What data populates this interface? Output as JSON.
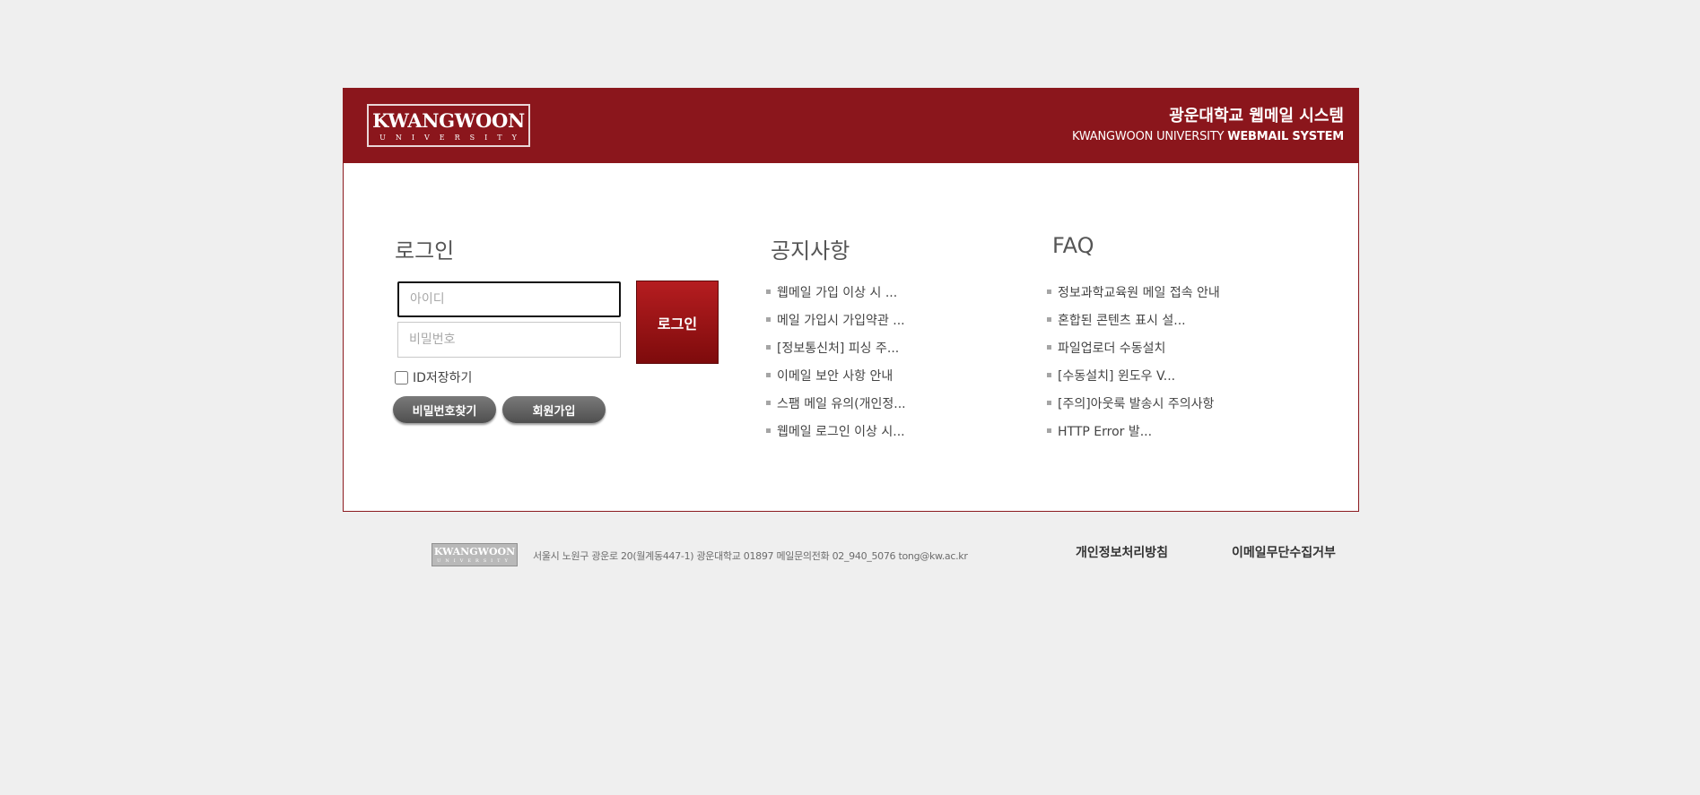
{
  "header": {
    "logo_main": "KWANGWOON",
    "logo_sub": "UNIVERSITY",
    "title_kr": "광운대학교 웹메일 시스템",
    "title_en_prefix": "KWANGWOON UNIVERSITY",
    "title_en_bold": "WEBMAIL SYSTEM"
  },
  "login": {
    "title": "로그인",
    "id_placeholder": "아이디",
    "pw_placeholder": "비밀번호",
    "login_button": "로그인",
    "remember_label": "ID저장하기",
    "find_pw_button": "비밀번호찾기",
    "signup_button": "회원가입"
  },
  "notice": {
    "title": "공지사항",
    "items": [
      "웹메일 가입 이상 시 ...",
      "메일 가입시 가입약관 ...",
      "[정보통신처] 피싱 주...",
      "이메일 보안 사항 안내",
      "스팸 메일 유의(개인정...",
      "웹메일 로그인 이상 시..."
    ]
  },
  "faq": {
    "title": "FAQ",
    "items": [
      "정보과학교육원 메일 접속 안내",
      "혼합된 콘텐츠 표시 설...",
      "파일업로더 수동설치",
      "[수동설치] 윈도우 V...",
      "[주의]아웃룩 발송시 주의사항",
      "HTTP Error 발..."
    ]
  },
  "footer": {
    "logo_main": "KWANGWOON",
    "logo_sub": "UNIVERSITY",
    "address": "서울시 노원구 광운로 20(월계동447-1) 광운대학교 01897   메일문의전화 02_940_5076   tong@kw.ac.kr",
    "privacy_link": "개인정보처리방침",
    "email_refuse_link": "이메일무단수집거부"
  }
}
